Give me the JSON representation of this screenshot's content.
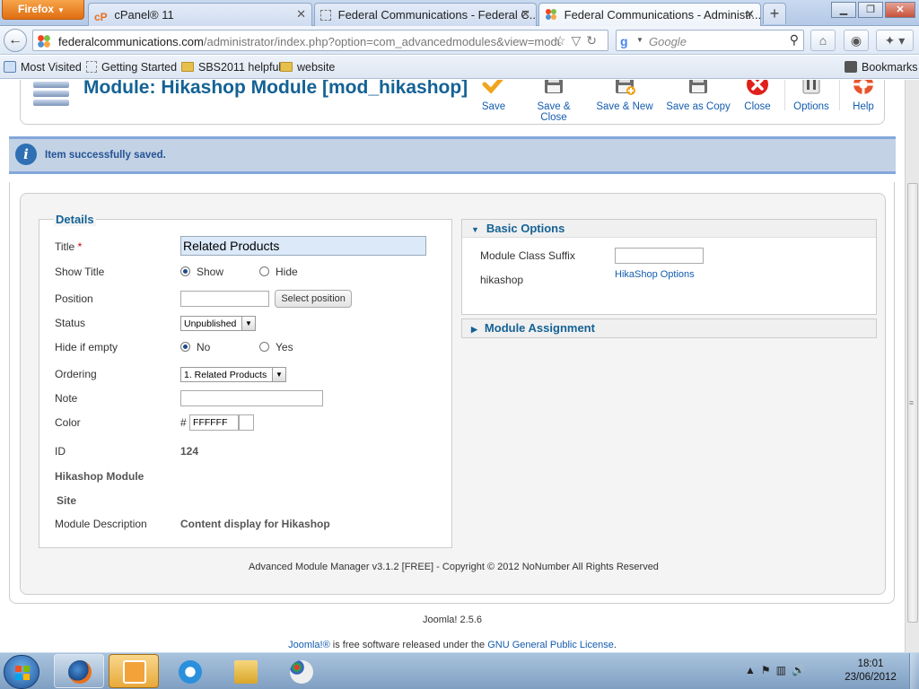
{
  "browser": {
    "app_button": "Firefox",
    "tabs": [
      {
        "title": "cPanel® 11"
      },
      {
        "title": "Federal Communications - Federal C..."
      },
      {
        "title": "Federal Communications - Administr..."
      }
    ],
    "url_host": "federalcommunications.com",
    "url_path": "/administrator/index.php?option=com_advancedmodules&view=module&",
    "search_placeholder": "Google",
    "bookmarks": [
      "Most Visited",
      "Getting Started",
      "SBS2011 helpful",
      "website"
    ],
    "bookmarks_menu": "Bookmarks"
  },
  "toolbar": {
    "title": "Module: Hikashop Module [mod_hikashop]",
    "buttons": {
      "save": "Save",
      "save_close": "Save & Close",
      "save_new": "Save & New",
      "save_copy": "Save as Copy",
      "close": "Close",
      "options": "Options",
      "help": "Help"
    }
  },
  "message": "Item successfully saved.",
  "details": {
    "legend": "Details",
    "title_label": "Title",
    "required_mark": "*",
    "title_value": "Related Products",
    "show_title_label": "Show Title",
    "show_option": "Show",
    "hide_option": "Hide",
    "position_label": "Position",
    "position_value": "",
    "select_position": "Select position",
    "status_label": "Status",
    "status_value": "Unpublished",
    "hide_if_empty_label": "Hide if empty",
    "no_option": "No",
    "yes_option": "Yes",
    "ordering_label": "Ordering",
    "ordering_value": "1. Related Products",
    "note_label": "Note",
    "note_value": "",
    "color_label": "Color",
    "color_hash": "#",
    "color_value": "FFFFFF",
    "id_label": "ID",
    "id_value": "124",
    "module_type": "Hikashop Module",
    "site_label": "Site",
    "description_label": "Module Description",
    "description_value": "Content display for Hikashop"
  },
  "basic_options": {
    "heading": "Basic Options",
    "suffix_label": "Module Class Suffix",
    "suffix_value": "",
    "hikashop_label": "hikashop",
    "hikashop_link": "HikaShop Options"
  },
  "module_assignment": {
    "heading": "Module Assignment"
  },
  "footer": {
    "amm": "Advanced Module Manager v3.1.2 [FREE] - Copyright © 2012 NoNumber All Rights Reserved",
    "version": "Joomla! 2.5.6",
    "joomla_link": "Joomla!®",
    "license_pre": " is free software released under the ",
    "license_link": "GNU General Public License",
    "license_post": "."
  },
  "taskbar": {
    "time": "18:01",
    "date": "23/06/2012"
  },
  "colors": {
    "title_blue": "#146295",
    "link_blue": "#135cae",
    "message_bg": "#c3d2e5",
    "message_border": "#84a7db"
  }
}
